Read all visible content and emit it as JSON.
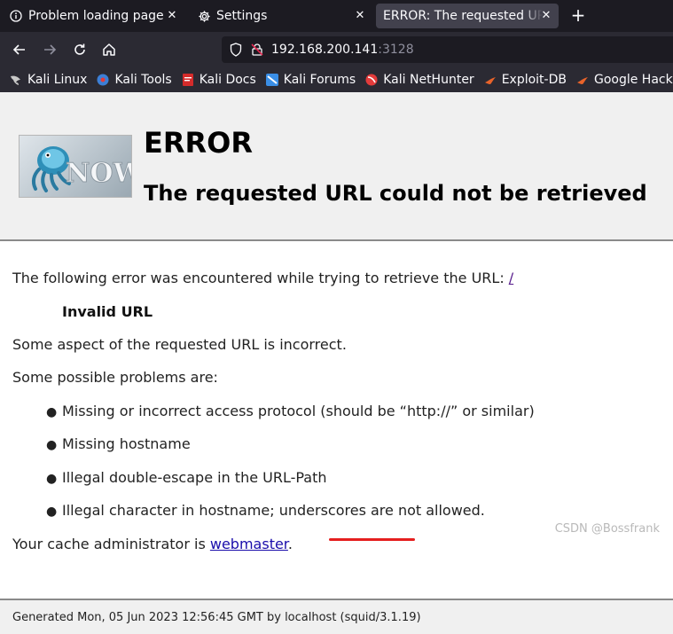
{
  "tabs": [
    {
      "title": "Problem loading page",
      "icon": "info-icon"
    },
    {
      "title": "Settings",
      "icon": "gear-icon"
    },
    {
      "title": "ERROR: The requested URL could not be retrieved",
      "icon": ""
    }
  ],
  "urlbar": {
    "host": "192.168.200.141",
    "port": ":3128"
  },
  "bookmarks": [
    {
      "label": "Kali Linux",
      "icon": "kali-dragon-icon",
      "color": "#c8c8c8"
    },
    {
      "label": "Kali Tools",
      "icon": "kali-tools-icon",
      "color": "#3c7fd6"
    },
    {
      "label": "Kali Docs",
      "icon": "kali-docs-icon",
      "color": "#d42b2b"
    },
    {
      "label": "Kali Forums",
      "icon": "kali-forums-icon",
      "color": "#3a8ee6"
    },
    {
      "label": "Kali NetHunter",
      "icon": "nethunter-icon",
      "color": "#e33b3b"
    },
    {
      "label": "Exploit-DB",
      "icon": "exploit-db-icon",
      "color": "#e8632a"
    },
    {
      "label": "Google Hacking DB",
      "icon": "ghdb-icon",
      "color": "#e8632a"
    }
  ],
  "header": {
    "title": "ERROR",
    "subtitle": "The requested URL could not be retrieved"
  },
  "content": {
    "intro": "The following error was encountered while trying to retrieve the URL: ",
    "url_link": "/",
    "error_name": "Invalid URL",
    "description": "Some aspect of the requested URL is incorrect.",
    "problems_intro": "Some possible problems are:",
    "problems": [
      "Missing or incorrect access protocol (should be “http://” or similar)",
      "Missing hostname",
      "Illegal double-escape in the URL-Path",
      "Illegal character in hostname; underscores are not allowed."
    ],
    "admin_prefix": "Your cache administrator is ",
    "admin_link": "webmaster",
    "admin_suffix": "."
  },
  "footer": {
    "generated": "Generated Mon, 05 Jun 2023 12:56:45 GMT by localhost (squid/3.1.19)"
  },
  "watermark": "CSDN @Bossfrank",
  "colors": {
    "tab_bg": "#1c1b22",
    "toolbar_bg": "#2b2a33",
    "active_tab": "#42414d",
    "link": "#1a0dab",
    "underline_mark": "#e51e1e"
  }
}
